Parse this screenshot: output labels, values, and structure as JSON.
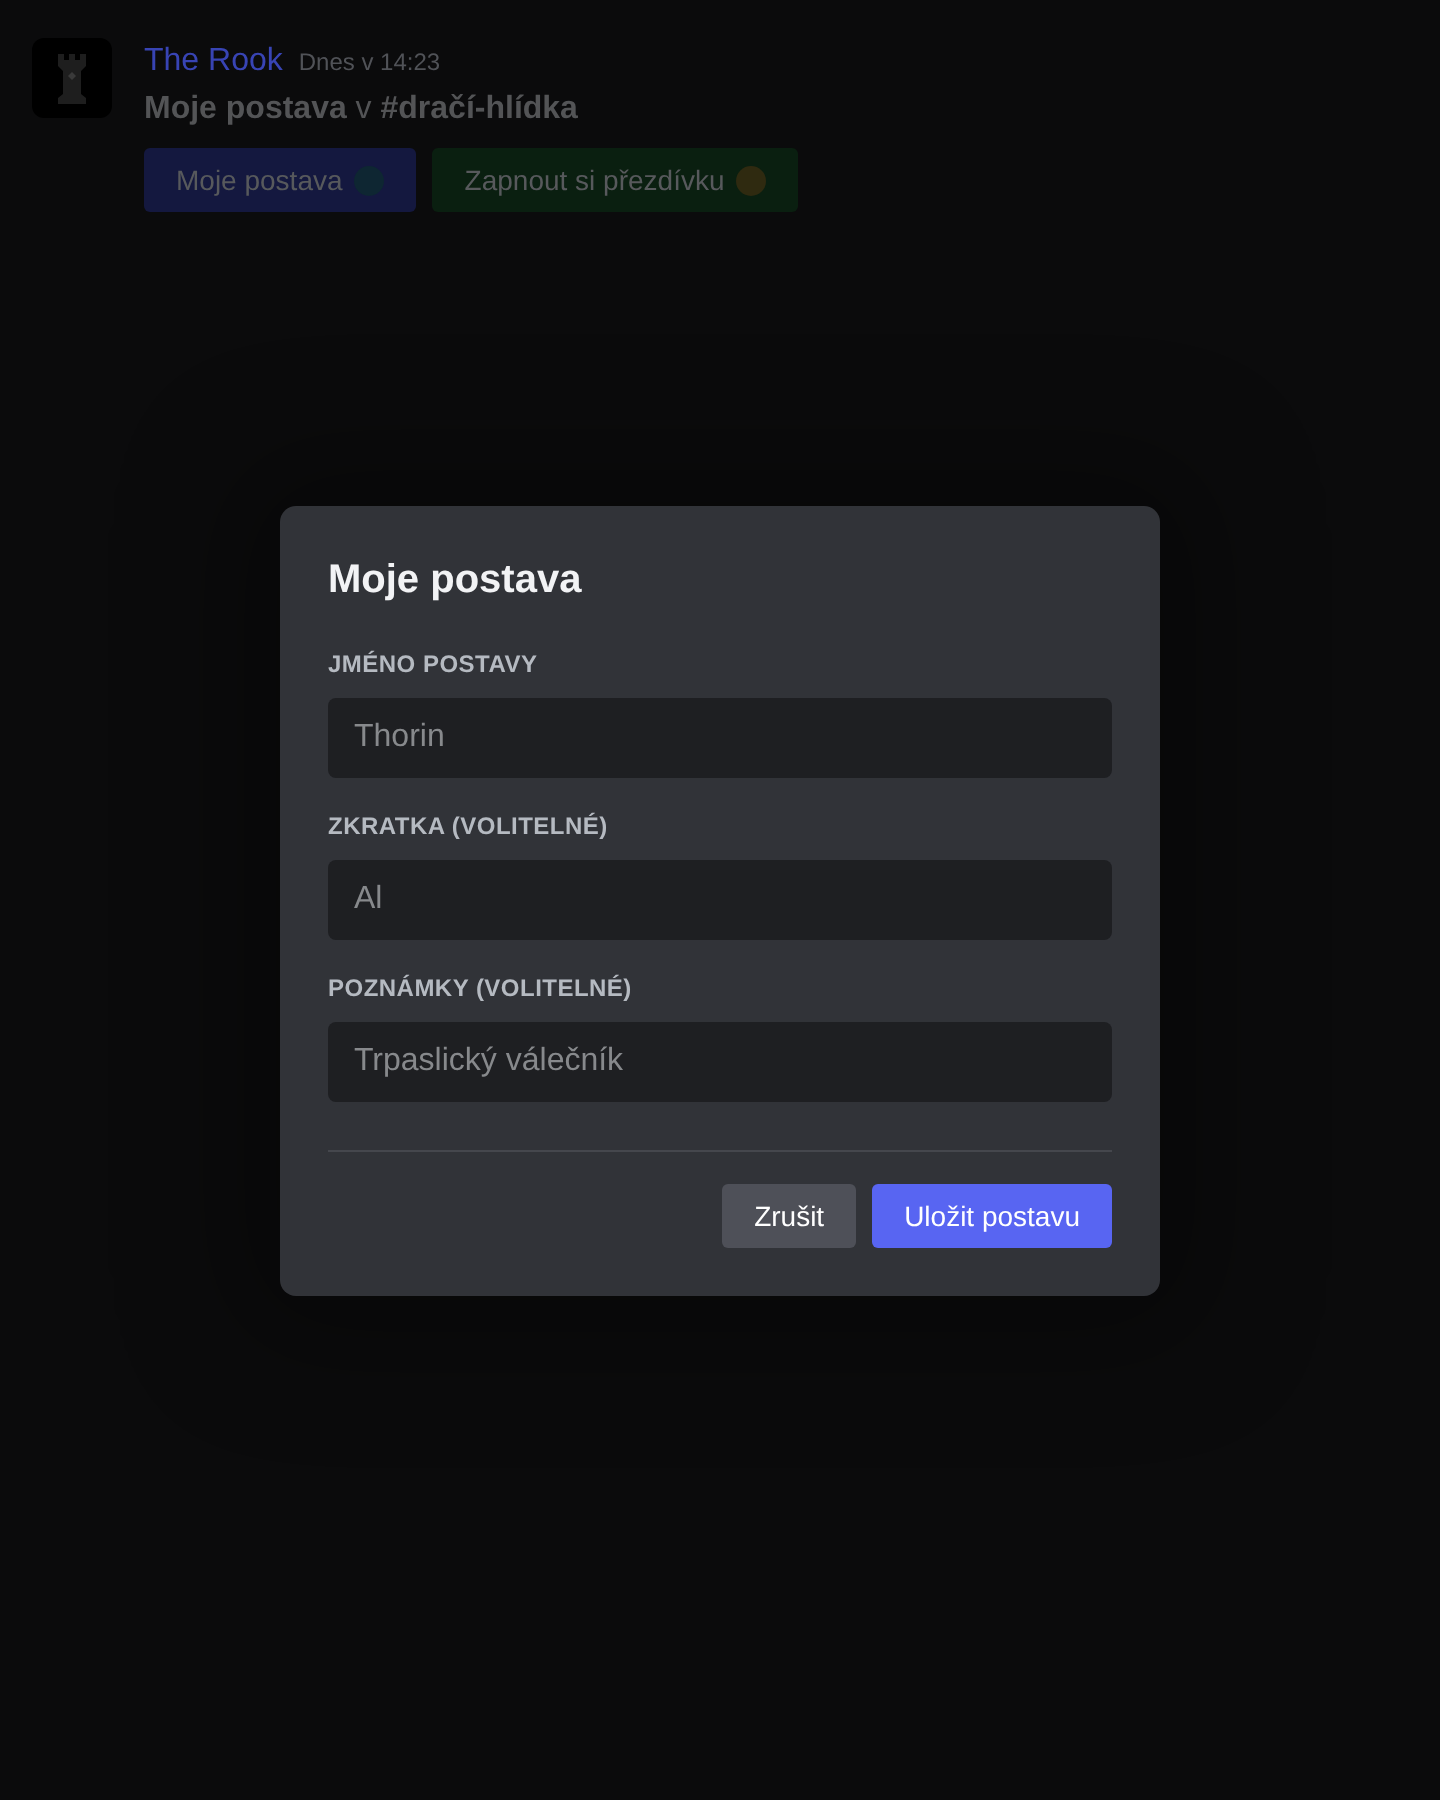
{
  "message": {
    "author": "The Rook",
    "timestamp": "Dnes v 14:23",
    "content": "**Moje postava** v **#dračí-hlídka**",
    "buttons": [
      {
        "label": "Moje postava",
        "kind": "primary",
        "color": "#0e2632"
      },
      {
        "label": "Zapnout si přezdívku",
        "kind": "success",
        "color": "#2f2a10"
      }
    ]
  },
  "dialog": {
    "title": "Moje postava",
    "fields": [
      {
        "label": "JMÉNO POSTAVY",
        "placeholder": "Thorin"
      },
      {
        "label": "ZKRATKA (VOLITELNÉ)",
        "placeholder": "Al"
      },
      {
        "label": "POZNÁMKY (VOLITELNÉ)",
        "placeholder": "Trpaslický válečník"
      }
    ],
    "buttons": [
      {
        "label": "Zrušit",
        "kind": "secondary"
      },
      {
        "label": "Uložit postavu",
        "kind": "primary"
      }
    ]
  }
}
